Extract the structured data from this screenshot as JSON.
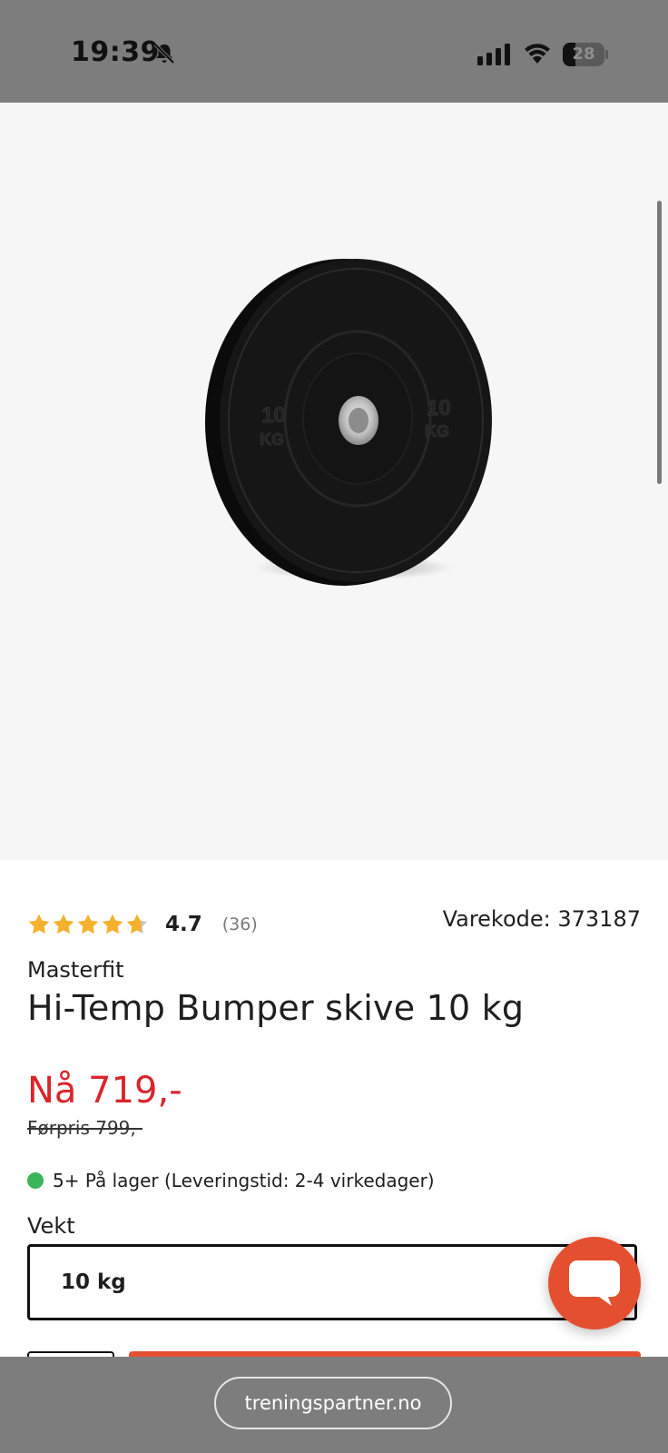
{
  "status_bar": {
    "time": "19:39",
    "battery_level": "28",
    "icons": [
      "bell-muted-icon",
      "cellular-signal-icon",
      "wifi-icon",
      "battery-icon"
    ]
  },
  "product": {
    "image": "black bumper plate",
    "plate_labels": [
      "10",
      "KG",
      "10",
      "KG"
    ],
    "rating": {
      "stars": 4.7,
      "value_text": "4.7",
      "count_text": "(36)"
    },
    "sku_text": "Varekode: 373187",
    "brand": "Masterfit",
    "title": "Hi-Temp Bumper skive 10 kg",
    "price_now": "Nå 719,-",
    "price_before": "Førpris 799,-",
    "stock_text": "5+ På lager (Leveringstid: 2-4 virkedager)",
    "weight_label": "Vekt",
    "weight_selected": "10 kg"
  },
  "browser": {
    "url": "treningspartner.no"
  },
  "colors": {
    "price": "#d9262c",
    "star": "#f5b12b",
    "star_empty": "#c8c8c8",
    "in_stock": "#3cb55a",
    "chat": "#e4502f",
    "bars": "#7d7d7d"
  }
}
